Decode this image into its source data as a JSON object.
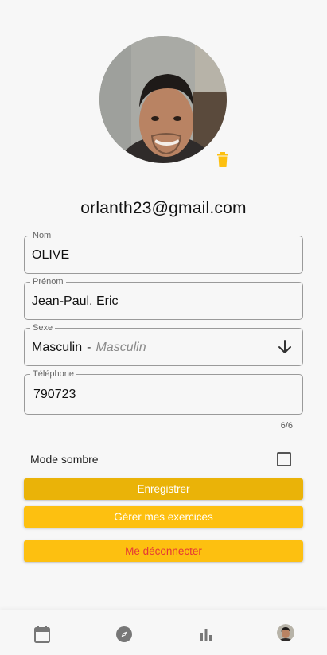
{
  "profile": {
    "email": "orlanth23@gmail.com",
    "avatar_icon": "add-photo-icon",
    "delete_icon": "trash-icon"
  },
  "fields": {
    "nom": {
      "label": "Nom",
      "value": "OLIVE"
    },
    "prenom": {
      "label": "Prénom",
      "value": "Jean-Paul, Eric"
    },
    "sexe": {
      "label": "Sexe",
      "value": "Masculin",
      "separator": "-",
      "hint": "Masculin"
    },
    "telephone": {
      "label": "Téléphone",
      "value": "790723",
      "counter": "6/6"
    }
  },
  "settings": {
    "dark_mode_label": "Mode sombre",
    "dark_mode_checked": false
  },
  "buttons": {
    "save": "Enregistrer",
    "exercises": "Gérer mes exercices",
    "logout": "Me déconnecter"
  },
  "nav": {
    "items": [
      "calendar-icon",
      "compass-icon",
      "bar-chart-icon",
      "profile-avatar"
    ]
  },
  "colors": {
    "accent": "#fdc010",
    "accent_dark": "#eab308",
    "danger": "#e53935"
  }
}
